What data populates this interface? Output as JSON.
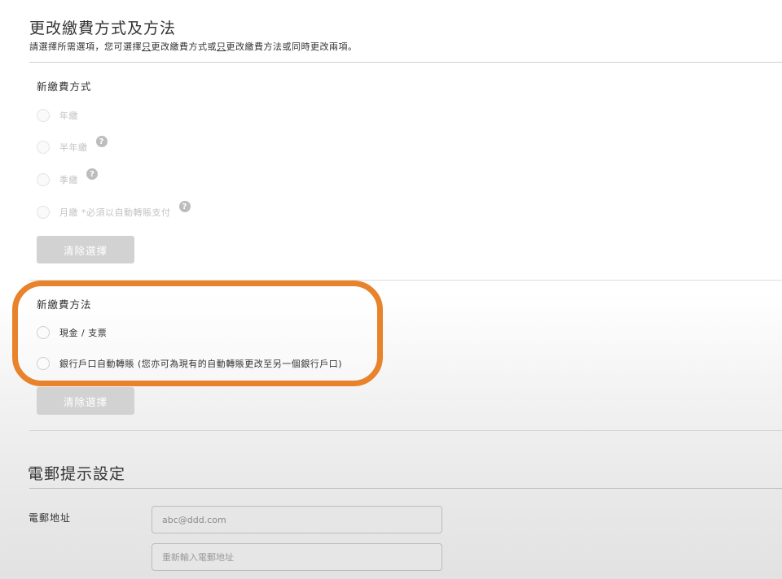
{
  "header": {
    "title": "更改繳費方式及方法",
    "subtitle_parts": [
      "請選擇所需選項，您可選擇",
      "只",
      "更改繳費方式或",
      "只",
      "更改繳費方法或同時更改兩項。"
    ]
  },
  "payment_mode": {
    "label": "新繳費方式",
    "options": [
      {
        "label": "年繳",
        "help": false
      },
      {
        "label": "半年繳",
        "help": true
      },
      {
        "label": "季繳",
        "help": true
      },
      {
        "label": "月繳 *必須以自動轉賬支付",
        "help": true
      }
    ],
    "clear_label": "清除選擇"
  },
  "payment_method": {
    "label": "新繳費方法",
    "options": [
      {
        "label": "現金 / 支票"
      },
      {
        "label": "銀行戶口自動轉賬 (您亦可為現有的自動轉賬更改至另一個銀行戶口)"
      }
    ],
    "clear_label": "清除選擇"
  },
  "email_section": {
    "title": "電郵提示設定",
    "email_label": "電郵地址",
    "email_value": "abc@ddd.com",
    "confirm_placeholder": "重新輸入電郵地址"
  },
  "help_glyph": "?",
  "colors": {
    "highlight": "#e8822b",
    "button_disabled": "#d2d2d2"
  }
}
